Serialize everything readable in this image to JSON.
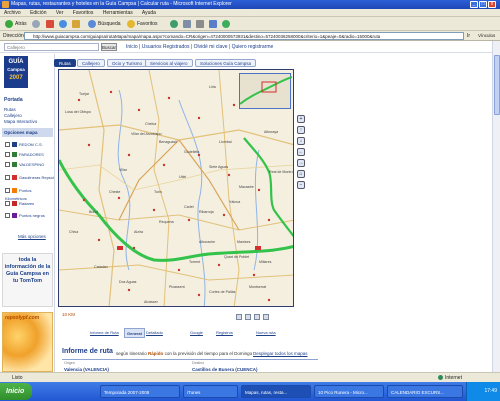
{
  "window": {
    "title": "Mapas, rutas, restaurantes y hoteles en la Guía Campsa | Calcular ruta - Microsoft Internet Explorer",
    "minimize": "_",
    "maximize": "□",
    "close": "x"
  },
  "menu": [
    "Archivo",
    "Edición",
    "Ver",
    "Favoritos",
    "Herramientas",
    "Ayuda"
  ],
  "toolbar": {
    "back": "Atrás",
    "search": "Búsqueda",
    "favorites": "Favoritos"
  },
  "address": {
    "label": "Dirección",
    "url": "http://www.guiacampsa.com/guiapsa/rutaMapa/mapa/mapa.aspx?comando=CR&origen=47240000573931&destino=57240036258000&criterio=1&peaje=0&radio=15000&ruta",
    "go": "Ir",
    "links": "Vínculos"
  },
  "site": {
    "search_placeholder": "Callejero",
    "search_button": "Buscar",
    "login_links": "Inicio | Usuarios Registrados | Olvidé mi clave | Quiero registrarme",
    "logo_line1": "GUÍA",
    "logo_line2": "Campsa",
    "logo_year": "2007"
  },
  "sidebar": {
    "section": "Portada",
    "links": [
      "Rutas",
      "Callejero",
      "Mapa Interactivo"
    ],
    "options_title": "Opciones mapa",
    "options": [
      {
        "label": "REDOM C.S.",
        "color": "#1d3f88"
      },
      {
        "label": "PARADORES",
        "color": "#2e7d32"
      },
      {
        "label": "VALDESPINO",
        "color": "#2e7d32"
      },
      {
        "label": "Gasolineras Repsol",
        "color": "#d32f2f"
      },
      {
        "label": "Puntos Kilométricos",
        "color": "#f57c00"
      },
      {
        "label": "Radares",
        "color": "#c62828"
      },
      {
        "label": "Puntos negros",
        "color": "#6a1b9a"
      }
    ],
    "more_options": "Más opciones",
    "tomtom_text": "toda la información de la Guía Campsa en tu TomTom",
    "ad_text": "repsolypf.com"
  },
  "tabs": [
    {
      "label": "Rutas",
      "active": true
    },
    {
      "label": "Callejero",
      "active": false
    },
    {
      "label": "Ocio y Turismo",
      "active": false
    },
    {
      "label": "Servicios al viajero",
      "active": false
    },
    {
      "label": "Soluciones Guía Campsa",
      "active": false
    }
  ],
  "map": {
    "scale": "10 KM",
    "towns": [
      "Villar del Arzobispo",
      "Chelva",
      "Tuéjar",
      "Losa del Obispo",
      "Liria",
      "Bétera",
      "Alboraya",
      "Villar",
      "Buñol",
      "Chiva",
      "Cheste",
      "Godelleta",
      "Turís",
      "Alborache",
      "Yátova",
      "Requena",
      "Utiel",
      "Siete Aguas",
      "Macastre",
      "Dos Aguas",
      "Cortes de Pallás",
      "Millares",
      "Manises",
      "Quart de Poblet",
      "Torrent",
      "Picassent",
      "Alcàsser",
      "Montserrat",
      "Real de Montroi",
      "Catadau",
      "Alzira",
      "Carlet",
      "Llombai",
      "Benaguasil",
      "Ribarroja"
    ],
    "controls": [
      "+",
      "−",
      "↑",
      "↓",
      "←",
      "→",
      "⌂"
    ]
  },
  "bottom_tabs": [
    {
      "label": "Informe de Ruta",
      "active": false
    },
    {
      "label": "General",
      "active": true
    },
    {
      "label": "Detallado",
      "active": false
    },
    {
      "label": "Google",
      "active": false
    },
    {
      "label": "Registros",
      "active": false
    },
    {
      "label": "Nueva ruta",
      "active": false
    }
  ],
  "informe": {
    "title": "Informe de ruta",
    "sub_prefix": "según itinerario",
    "sub_mode": "Rápido",
    "sub_suffix": "con la previsión del tiempo para el Domingo",
    "link": "Desplegar todos los mapas",
    "origin_label": "Origen",
    "origin": "Valencia (VALENCIA)",
    "dest_label": "Destino",
    "dest": "Castillos de Bunera (CUENCA)"
  },
  "status": {
    "text": "Listo",
    "zone": "Internet"
  },
  "taskbar": {
    "start": "Inicio",
    "tasks": [
      {
        "label": "Temporada 2007-2008",
        "active": false
      },
      {
        "label": "iTunes",
        "active": false
      },
      {
        "label": "Mapas, rutas, resta...",
        "active": true
      },
      {
        "label": "10 Pico Runera - Micro...",
        "active": false
      },
      {
        "label": "CALENDARIO EXCURS...",
        "active": false
      }
    ],
    "clock": "17:49"
  },
  "colors": {
    "route": "#33c24a",
    "brand": "#1d3f88",
    "xp_blue": "#2157d3"
  }
}
